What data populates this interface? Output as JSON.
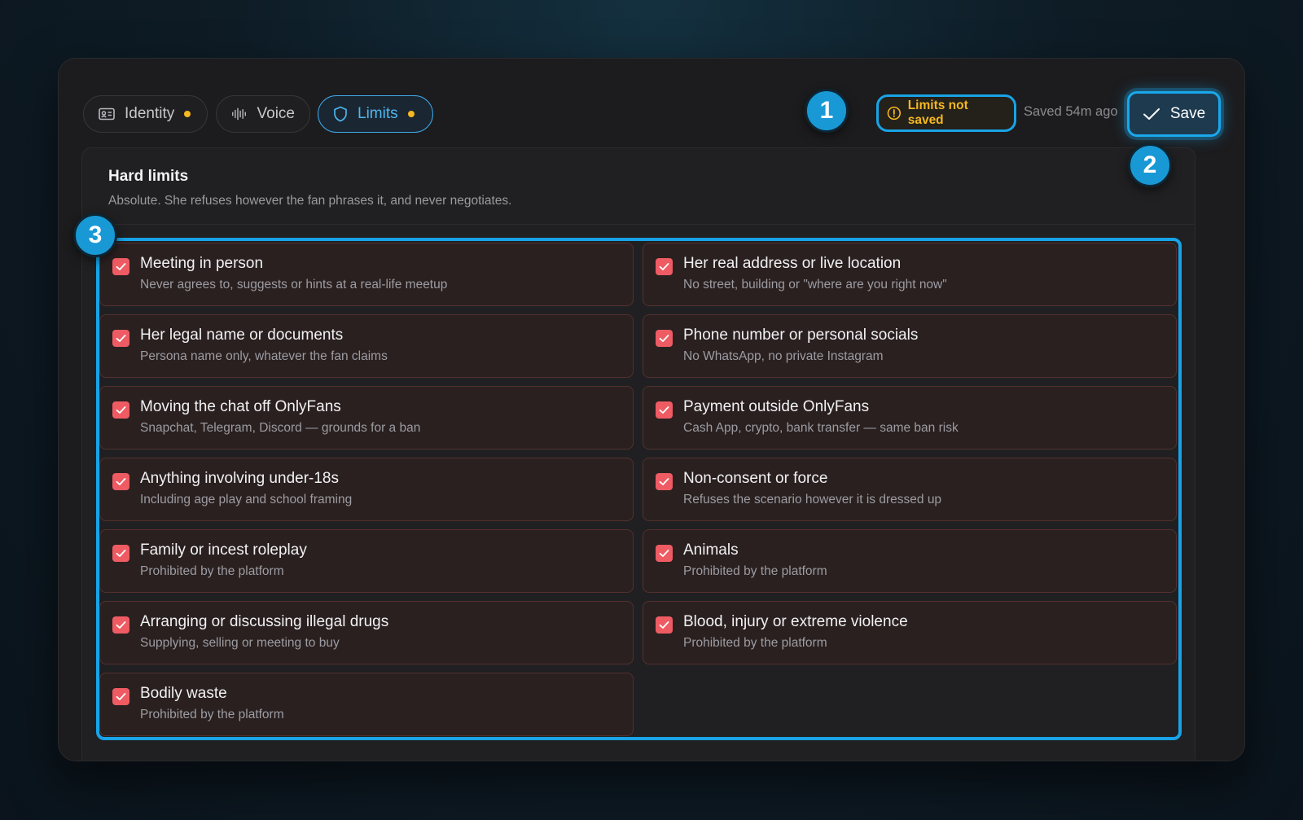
{
  "tabs": [
    {
      "label": "Identity",
      "icon": "id-card-icon",
      "unsaved": true
    },
    {
      "label": "Voice",
      "icon": "waveform-icon",
      "unsaved": false
    },
    {
      "label": "Limits",
      "icon": "shield-icon",
      "unsaved": true,
      "active": true
    }
  ],
  "status": {
    "unsaved_label": "Limits not saved",
    "saved_label": "Saved 54m ago"
  },
  "save_button": {
    "label": "Save"
  },
  "badges": [
    "1",
    "2",
    "3"
  ],
  "section": {
    "title": "Hard limits",
    "subtitle": "Absolute. She refuses however the fan phrases it, and never negotiates."
  },
  "limits": [
    {
      "title": "Meeting in person",
      "desc": "Never agrees to, suggests or hints at a real-life meetup",
      "checked": true
    },
    {
      "title": "Her real address or live location",
      "desc": "No street, building or \"where are you right now\"",
      "checked": true
    },
    {
      "title": "Her legal name or documents",
      "desc": "Persona name only, whatever the fan claims",
      "checked": true
    },
    {
      "title": "Phone number or personal socials",
      "desc": "No WhatsApp, no private Instagram",
      "checked": true
    },
    {
      "title": "Moving the chat off OnlyFans",
      "desc": "Snapchat, Telegram, Discord — grounds for a ban",
      "checked": true
    },
    {
      "title": "Payment outside OnlyFans",
      "desc": "Cash App, crypto, bank transfer — same ban risk",
      "checked": true
    },
    {
      "title": "Anything involving under-18s",
      "desc": "Including age play and school framing",
      "checked": true
    },
    {
      "title": "Non-consent or force",
      "desc": "Refuses the scenario however it is dressed up",
      "checked": true
    },
    {
      "title": "Family or incest roleplay",
      "desc": "Prohibited by the platform",
      "checked": true
    },
    {
      "title": "Animals",
      "desc": "Prohibited by the platform",
      "checked": true
    },
    {
      "title": "Arranging or discussing illegal drugs",
      "desc": "Supplying, selling or meeting to buy",
      "checked": true
    },
    {
      "title": "Blood, injury or extreme violence",
      "desc": "Prohibited by the platform",
      "checked": true
    },
    {
      "title": "Bodily waste",
      "desc": "Prohibited by the platform",
      "checked": true
    }
  ],
  "colors": {
    "accent": "#18a3e6",
    "warning": "#f5b820",
    "check": "#ef5b63"
  }
}
